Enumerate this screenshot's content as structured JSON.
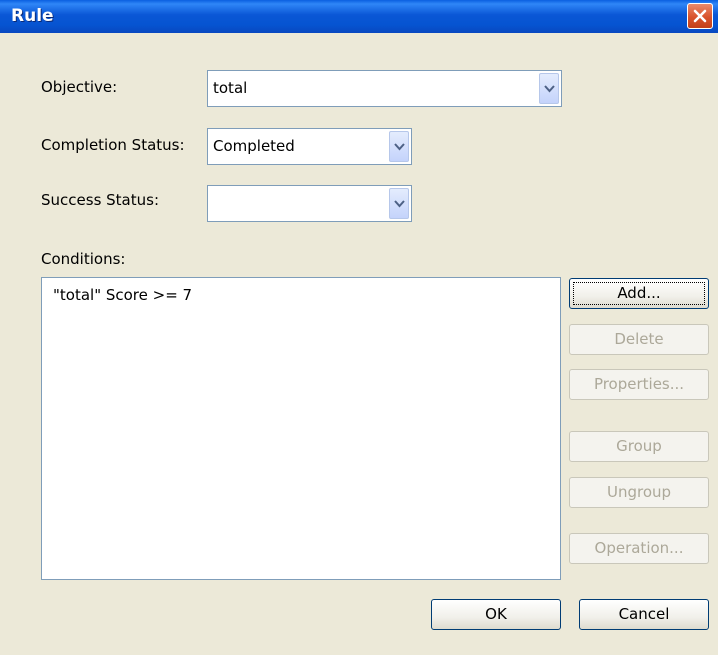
{
  "window": {
    "title": "Rule"
  },
  "form": {
    "objective_label": "Objective:",
    "objective_value": "total",
    "completion_label": "Completion Status:",
    "completion_value": "Completed",
    "success_label": "Success Status:",
    "success_value": "",
    "conditions_label": "Conditions:"
  },
  "conditions": [
    "\"total\" Score >= 7"
  ],
  "buttons": {
    "add": "Add...",
    "delete": "Delete",
    "properties": "Properties...",
    "group": "Group",
    "ungroup": "Ungroup",
    "operation": "Operation...",
    "ok": "OK",
    "cancel": "Cancel"
  }
}
